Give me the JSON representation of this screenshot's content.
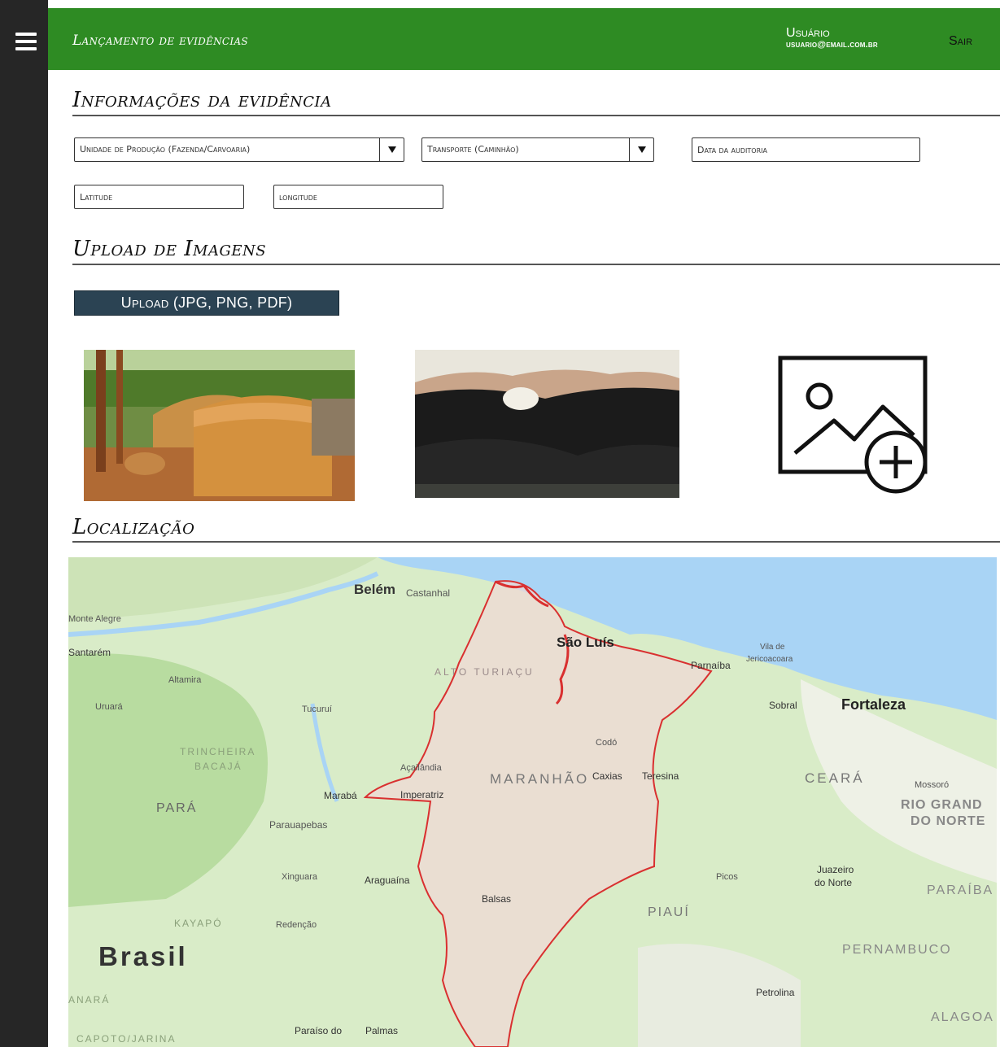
{
  "header": {
    "app_title": "Lançamento de evidências",
    "user_name": "Usuário",
    "user_email": "usuario@email.com.br",
    "logout_label": "Sair",
    "accent_color": "#2e8b23"
  },
  "sections": {
    "info_title": "Informações da evidência",
    "upload_title": "Upload de Imagens",
    "location_title": "Localização"
  },
  "form": {
    "unidade_select": "Unidade de Produção (Fazenda/Carvoaria)",
    "transporte_select": "Transporte (Caminhão)",
    "data_placeholder": "Data da auditoria",
    "latitude_placeholder": "Latitude",
    "longitude_placeholder": "longitude"
  },
  "upload": {
    "button_label": "Upload (JPG, PNG, PDF)",
    "images": [
      {
        "name": "charcoal-kiln-photo"
      },
      {
        "name": "charcoal-pile-photo"
      },
      {
        "name": "add-image-icon"
      }
    ]
  },
  "map": {
    "labels": {
      "belem": "Belém",
      "castanhal": "Castanhal",
      "monte_alegre": "Monte Alegre",
      "santarem": "Santarém",
      "altamira": "Altamira",
      "uruara": "Uruará",
      "tucurui": "Tucuruí",
      "trincheira": "TRINCHEIRA",
      "bacaja": "BACAJÁ",
      "para": "PARÁ",
      "maraba": "Marabá",
      "parauapebas": "Parauapebas",
      "xinguara": "Xinguara",
      "kayapo": "KAYAPÓ",
      "redencao": "Redenção",
      "brasil": "Brasil",
      "anara": "ANARÁ",
      "capoto": "CAPOTO/JARINA",
      "paraiso": "Paraíso do",
      "palmas": "Palmas",
      "sao_luis": "São Luís",
      "alto_turiacu": "ALTO TURIAÇU",
      "parnaiba": "Parnaíba",
      "vila_de": "Vila de",
      "jericoacoara": "Jericoacoara",
      "sobral": "Sobral",
      "fortaleza": "Fortaleza",
      "codo": "Codó",
      "acailandia": "Açailândia",
      "maranhao": "MARANHÃO",
      "caxias": "Caxias",
      "teresina": "Teresina",
      "imperatriz": "Imperatriz",
      "ceara": "CEARÁ",
      "mossoro": "Mossoró",
      "rio_grande": "RIO GRAND",
      "do_norte": "DO NORTE",
      "araguaina": "Araguaína",
      "balsas": "Balsas",
      "picos": "Picos",
      "juazeiro": "Juazeiro",
      "do_norte_city": "do Norte",
      "piaui": "PIAUÍ",
      "paraiba": "PARAÍBA",
      "pernambuco": "PERNAMBUCO",
      "petrolina": "Petrolina",
      "alagoas": "ALAGOA"
    }
  }
}
